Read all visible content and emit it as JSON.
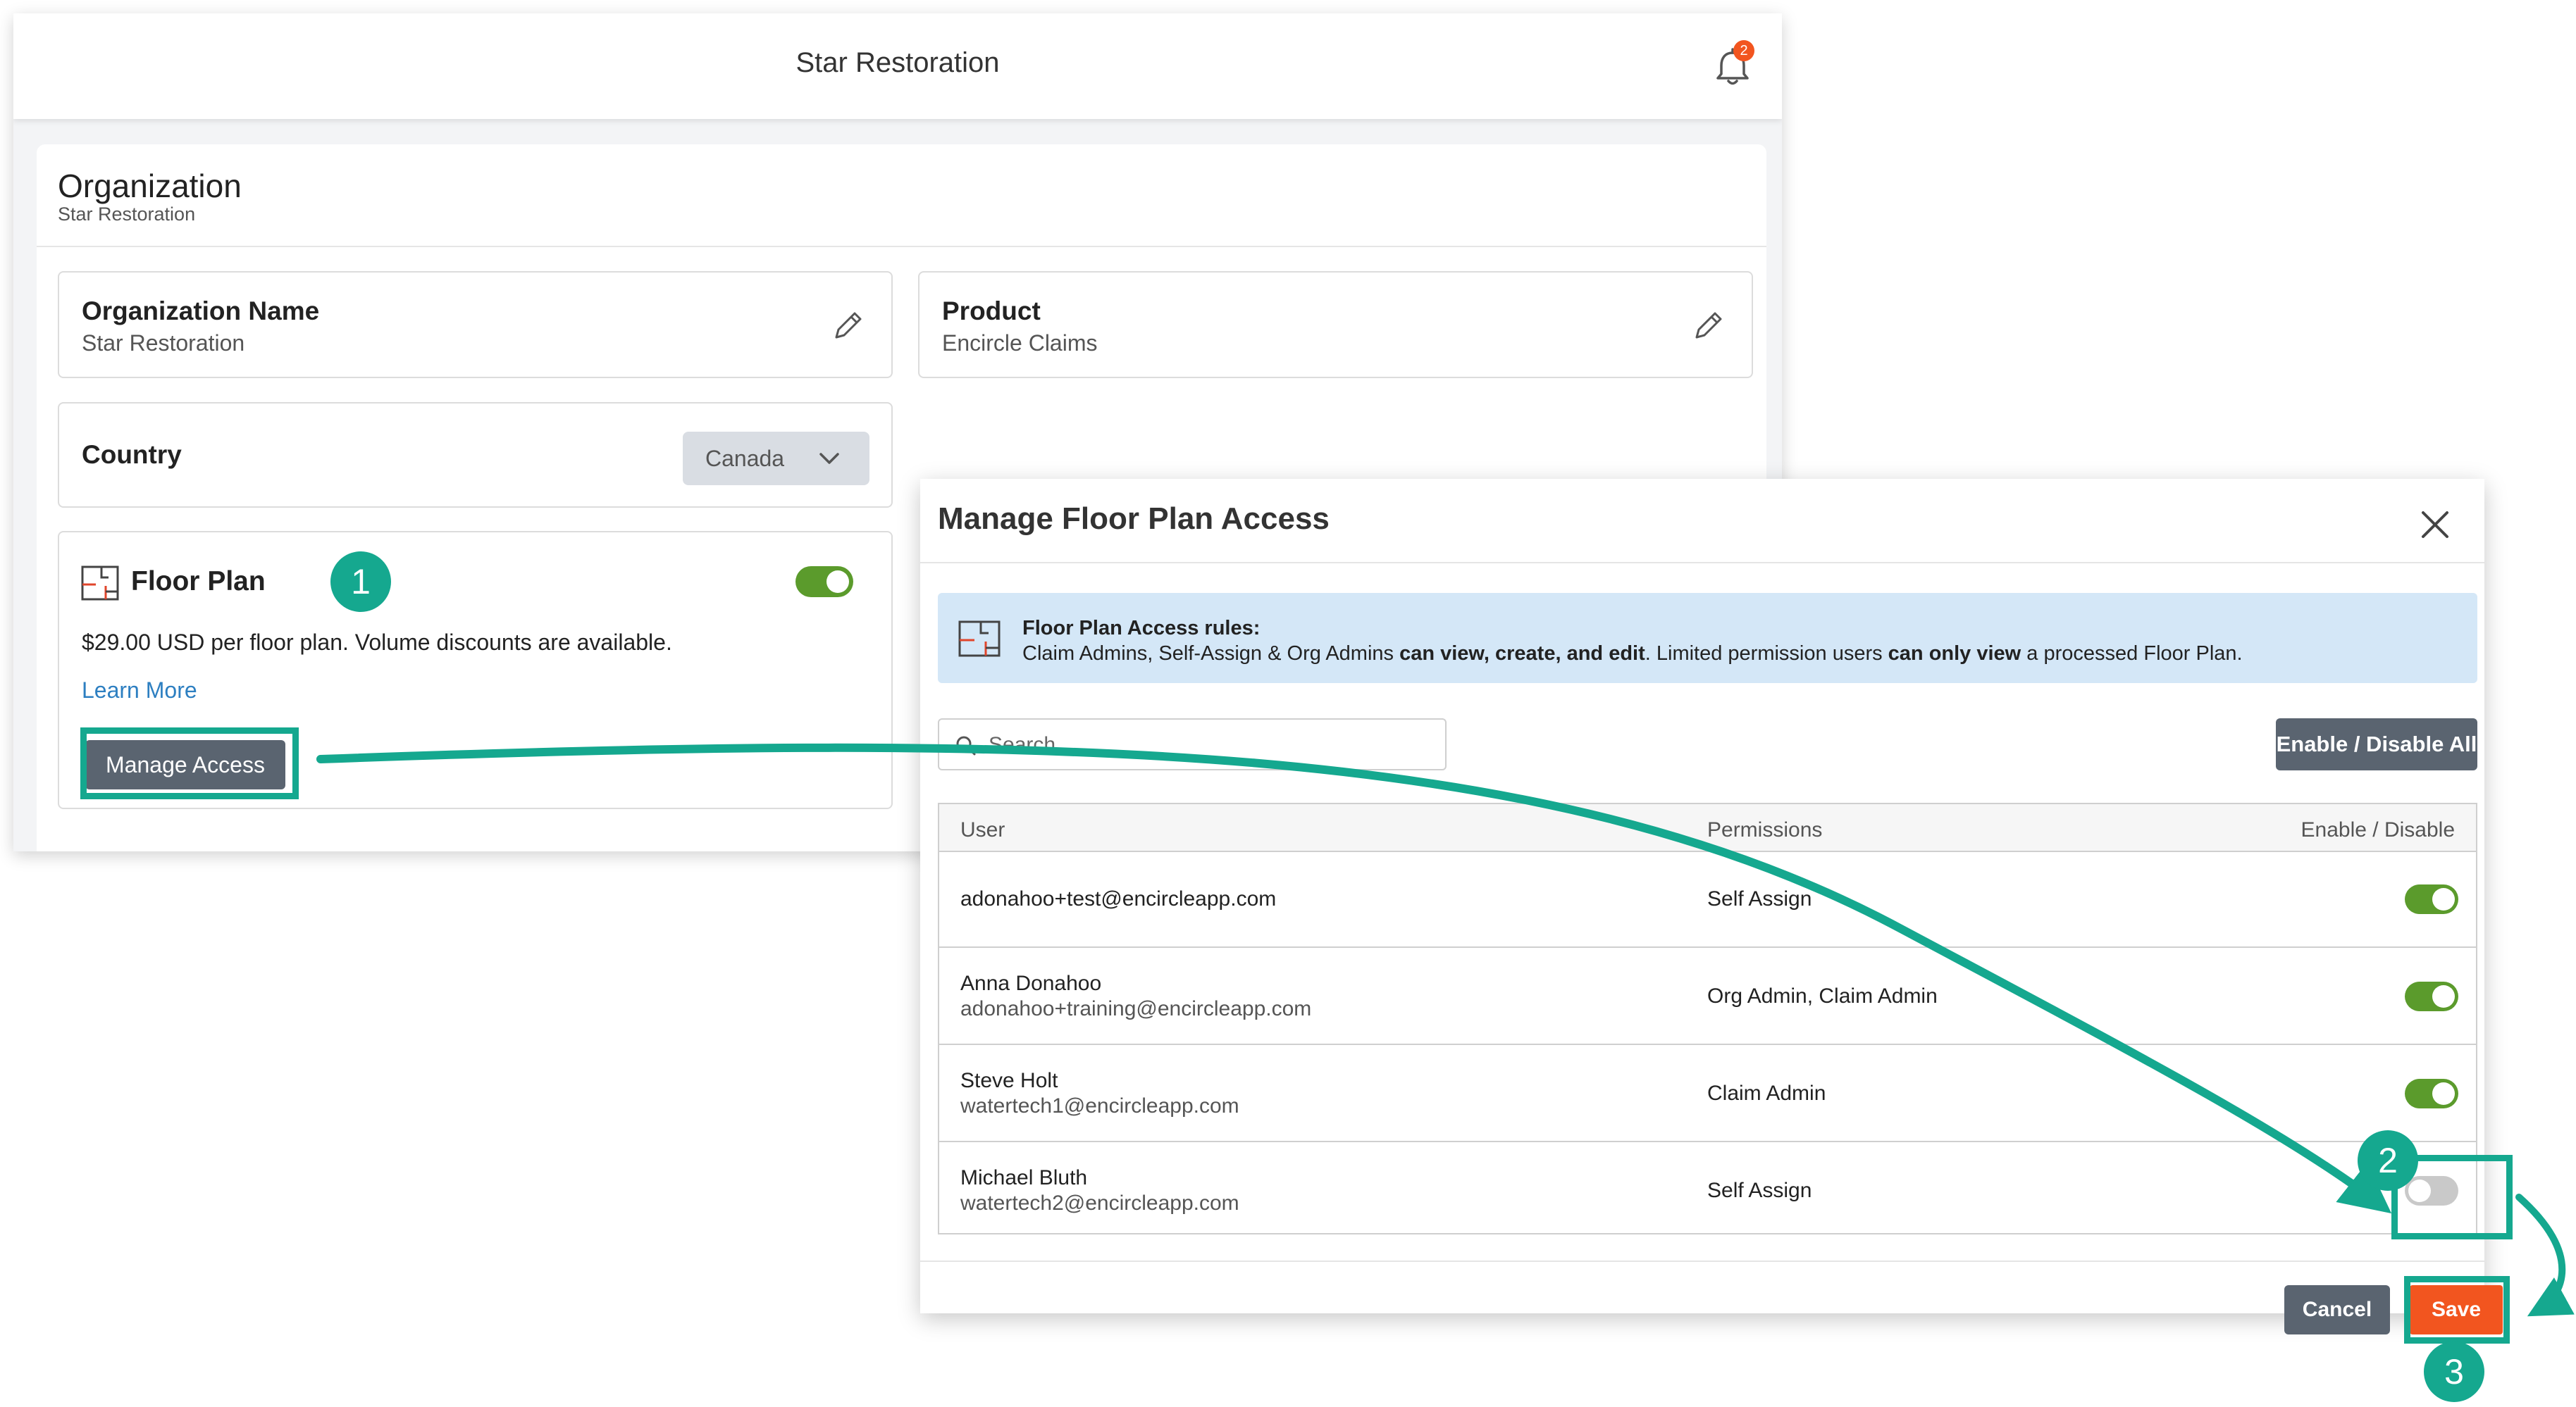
{
  "app": {
    "title": "Star Restoration",
    "notification_count": "2"
  },
  "organization": {
    "heading": "Organization",
    "subheading": "Star Restoration",
    "name_card": {
      "label": "Organization Name",
      "value": "Star Restoration"
    },
    "product_card": {
      "label": "Product",
      "value": "Encircle Claims"
    },
    "country_card": {
      "label": "Country",
      "selected": "Canada"
    },
    "floor_plan": {
      "title": "Floor Plan",
      "enabled": true,
      "price_text": "$29.00 USD per floor plan. Volume discounts are available.",
      "learn_more": "Learn More",
      "manage_button": "Manage Access"
    }
  },
  "modal": {
    "title": "Manage Floor Plan Access",
    "rules": {
      "title": "Floor Plan Access rules:",
      "text_1": "Claim Admins, Self-Assign & Org Admins ",
      "text_2": "can view, create, and edit",
      "text_3": ". Limited permission users ",
      "text_4": "can only view",
      "text_5": " a processed Floor Plan."
    },
    "search": {
      "placeholder": "Search...",
      "value": ""
    },
    "enable_all_button": "Enable / Disable All",
    "table": {
      "headers": {
        "user": "User",
        "permissions": "Permissions",
        "enable": "Enable / Disable"
      },
      "rows": [
        {
          "name": "",
          "email": "adonahoo+test@encircleapp.com",
          "permissions": "Self Assign",
          "enabled": true
        },
        {
          "name": "Anna Donahoo",
          "email": "adonahoo+training@encircleapp.com",
          "permissions": "Org Admin, Claim Admin",
          "enabled": true
        },
        {
          "name": "Steve Holt",
          "email": "watertech1@encircleapp.com",
          "permissions": "Claim Admin",
          "enabled": true
        },
        {
          "name": "Michael Bluth",
          "email": "watertech2@encircleapp.com",
          "permissions": "Self Assign",
          "enabled": false
        }
      ]
    },
    "cancel_button": "Cancel",
    "save_button": "Save"
  },
  "annotations": {
    "step_1": "1",
    "step_2": "2",
    "step_3": "3",
    "accent_color": "#15a88f"
  },
  "colors": {
    "toggle_on": "#5b9b2c",
    "toggle_off": "#c9c9c9",
    "save_button": "#f2551f",
    "secondary_button": "#5a6470",
    "info_box": "#d4e7f7",
    "link": "#2d7fc1"
  }
}
